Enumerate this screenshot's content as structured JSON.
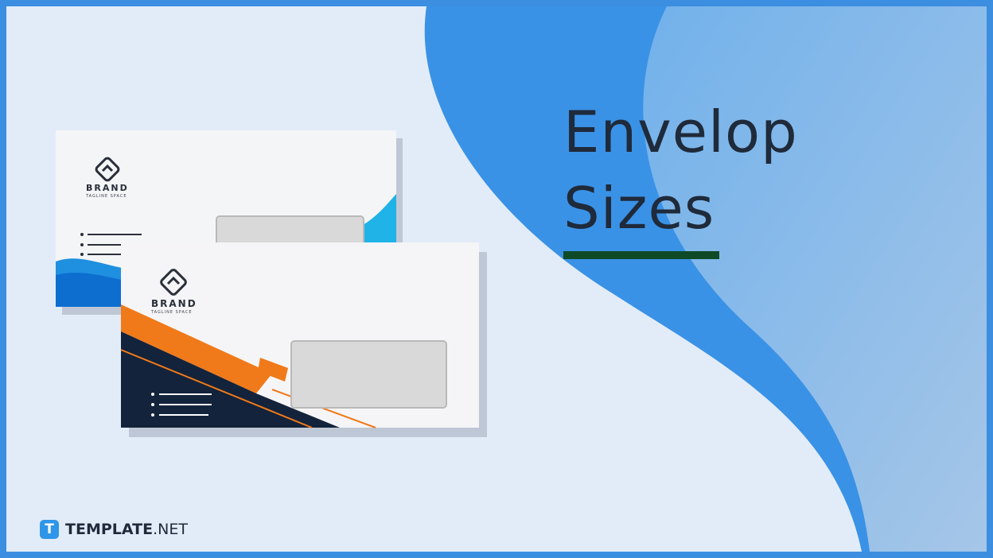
{
  "slide": {
    "title_line1": "Envelop",
    "title_line2": "Sizes"
  },
  "envelopes": {
    "back": {
      "brand": "BRAND",
      "tagline": "TAGLINE SPACE"
    },
    "front": {
      "brand": "BRAND",
      "tagline": "TAGLINE SPACE"
    }
  },
  "footer": {
    "logo_badge": "T",
    "logo_bold": "TEMPLATE",
    "logo_light": ".NET"
  },
  "colors": {
    "frame": "#3b8ee0",
    "background": "#e2ecf8",
    "wave_dark": "#3a92e6",
    "wave_light": "#8ec2ee",
    "title": "#1f2a3a",
    "underline": "#0f4a26",
    "accent_orange": "#f07a1a",
    "accent_navy": "#13233b",
    "accent_cyan": "#1fb3e8"
  }
}
